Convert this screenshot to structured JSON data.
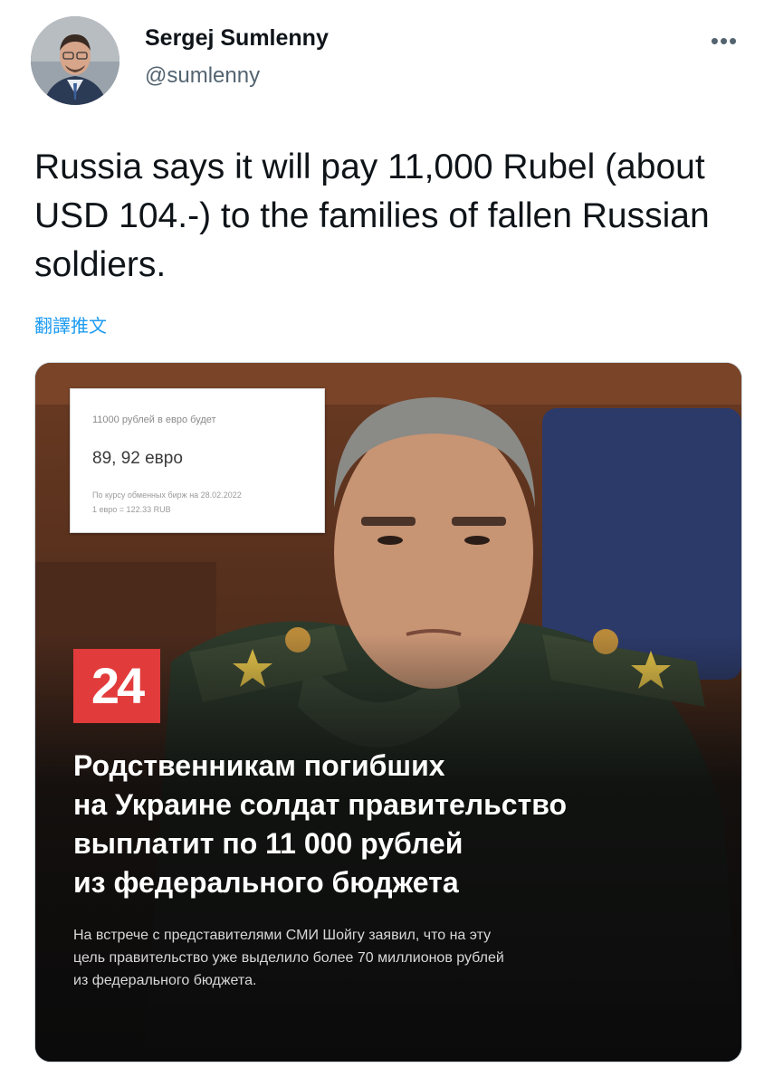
{
  "author": {
    "display_name": "Sergej Sumlenny",
    "handle": "@sumlenny"
  },
  "more_menu": {
    "icon": "more-horizontal-icon",
    "label": "•••"
  },
  "tweet": {
    "text": "Russia says it will pay 11,000 Rubel (about USD 104.-) to the families of fallen Russian soldiers.",
    "translate_label": "翻譯推文"
  },
  "media": {
    "rate_card": {
      "line1": "11000 рублей в евро будет",
      "line2": "89, 92 евро",
      "line3": "По курсу обменных бирж на 28.02.2022",
      "line4": "1 евро = 122.33 RUB"
    },
    "channel_logo": "24",
    "headline_lines": [
      "Родственникам погибших",
      "на Украине солдат правительство",
      "выплатит по 11 000 рублей",
      "из федерального бюджета"
    ],
    "subtext_lines": [
      "На встрече с представителями СМИ Шойгу заявил, что на эту",
      "цель правительство уже выделило более 70 миллионов рублей",
      "из федерального бюджета."
    ]
  },
  "colors": {
    "text": "#0f1419",
    "secondary": "#536471",
    "link": "#1d9bf0",
    "logo_red": "#e23b3b"
  }
}
